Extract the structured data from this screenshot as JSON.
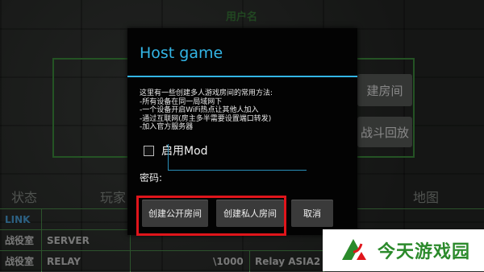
{
  "background": {
    "title": "用户名",
    "right_buttons": [
      "建房间",
      "战斗回放"
    ],
    "tabs": [
      "状态",
      "玩家",
      "地图"
    ],
    "table": [
      [
        "LINK",
        "",
        "",
        ""
      ],
      [
        "战役室",
        "SERVER",
        "",
        ""
      ],
      [
        "战役室",
        "RELAY",
        "\\1000",
        "Relay ASIA2"
      ]
    ]
  },
  "dialog": {
    "title": "Host game",
    "description": [
      "这里有一些创建多人游戏房间的常用方法:",
      "-所有设备在同一局域网下",
      "-一个设备开启WiFi热点让其他人加入",
      "-通过互联网(房主多半需要设置端口转发)",
      "-加入官方服务器"
    ],
    "mod_label": "启用Mod",
    "mod_checked": false,
    "password_label": "密码:",
    "password_value": "",
    "buttons": {
      "public": "创建公开房间",
      "private": "创建私人房间",
      "cancel": "取消"
    }
  },
  "watermark": {
    "text": "今天游戏园",
    "accent": "#2b8a2b"
  }
}
